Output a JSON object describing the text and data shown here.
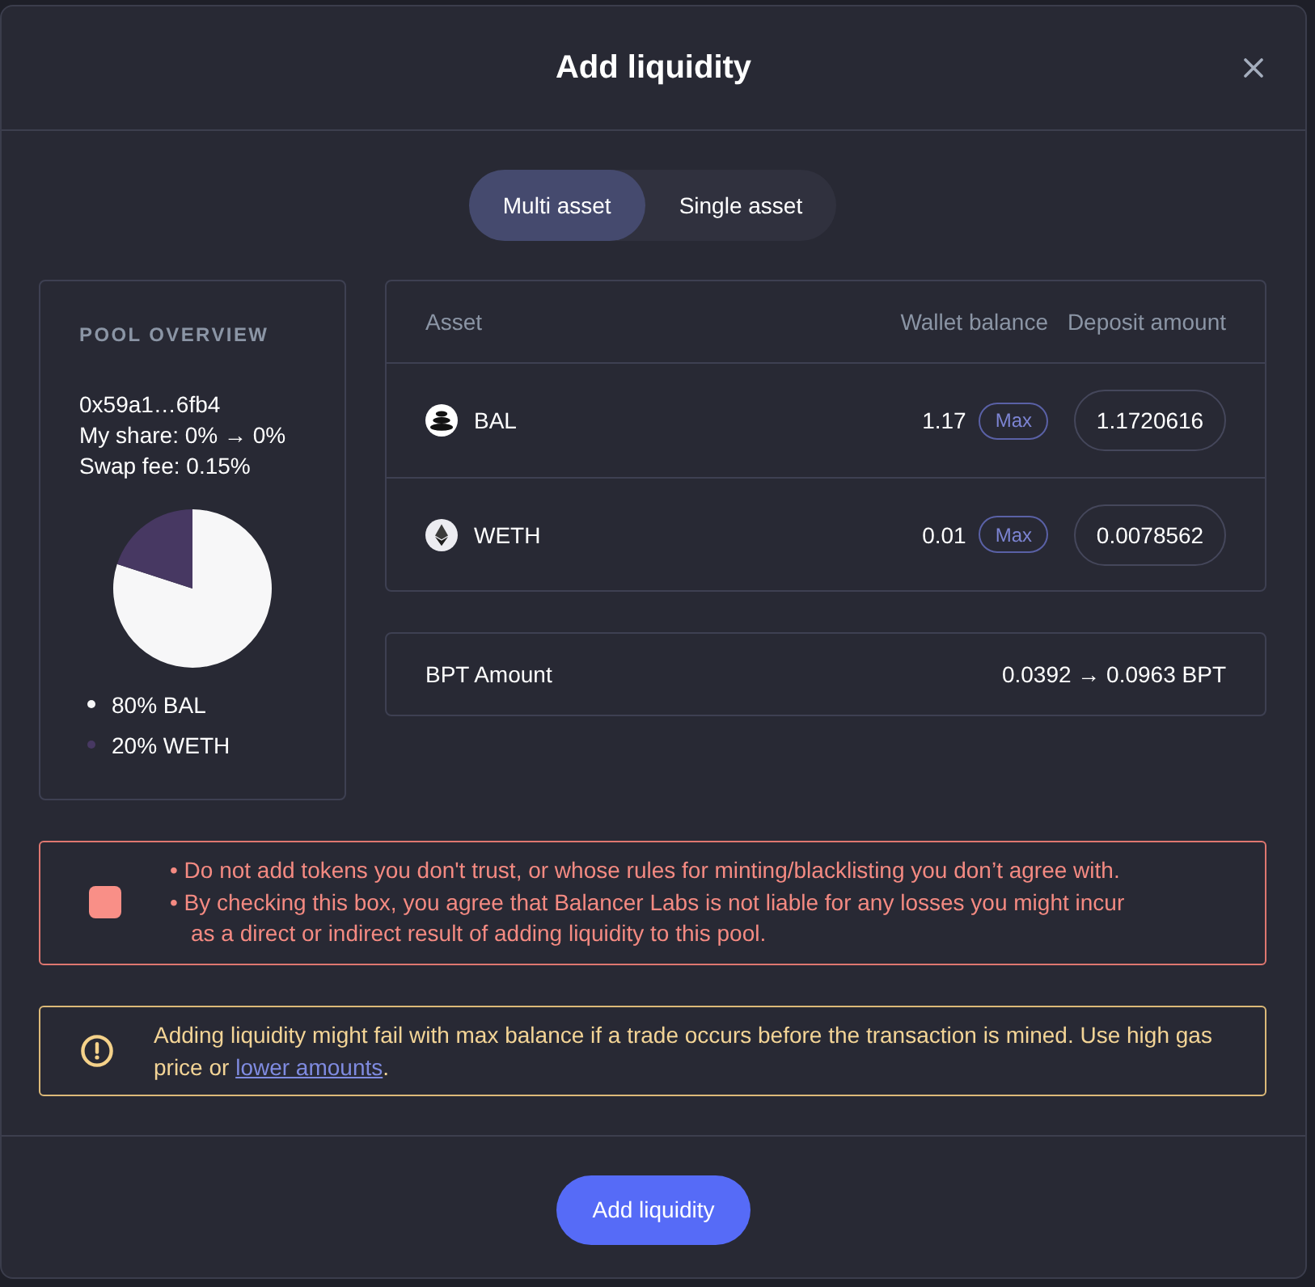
{
  "modal": {
    "title": "Add liquidity"
  },
  "tabs": [
    {
      "label": "Multi asset",
      "selected": true
    },
    {
      "label": "Single asset",
      "selected": false
    }
  ],
  "pool_overview": {
    "heading": "POOL OVERVIEW",
    "address": "0x59a1…6fb4",
    "my_share": "My share: 0% → 0%",
    "swap_fee": "Swap fee: 0.15%",
    "chart_data": {
      "type": "pie",
      "categories": [
        "BAL",
        "WETH"
      ],
      "values": [
        80,
        20
      ]
    },
    "legend": [
      {
        "share": "80%",
        "color": "#f7f7f8"
      },
      {
        "share": "20%",
        "color": "#473862"
      }
    ]
  },
  "assets": {
    "columns": [
      "Asset",
      "Wallet balance",
      "Deposit amount"
    ],
    "rows": [
      {
        "kind": "bal",
        "symbol": "BAL",
        "balance": "1.17",
        "max_label": "Max",
        "deposit": "1.1720616"
      },
      {
        "kind": "eth",
        "symbol": "WETH",
        "balance": "0.01",
        "max_label": "Max",
        "deposit": "0.0078562"
      }
    ]
  },
  "bpt": {
    "label": "BPT Amount",
    "value": "0.0392 → 0.0963 BPT"
  },
  "risk_notice": {
    "checked": false,
    "items": [
      "• Do not add tokens you don't trust, or whose rules for minting/blacklisting you don’t agree with.",
      "• By checking this box, you agree that Balancer Labs is not liable for any losses you might incur as a direct or indirect result of adding liquidity to this pool."
    ]
  },
  "gas_warning": {
    "text": "Adding liquidity might fail with max balance if a trade occurs before the transaction is mined. Use high gas price or ",
    "link": "lower amounts",
    "after": "."
  },
  "submit": {
    "label": "Add liquidity"
  }
}
